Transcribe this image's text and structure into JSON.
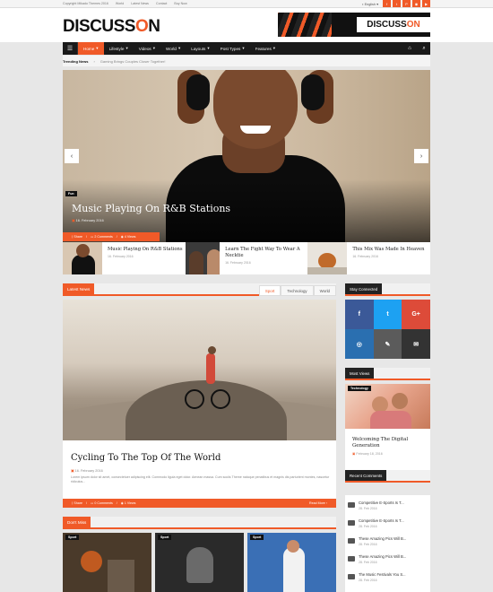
{
  "topbar": {
    "copyright": "Copyright Mikado Themes 2016",
    "links": [
      "World",
      "Latest News",
      "Contact",
      "Buy Now"
    ],
    "language": "English",
    "social": [
      "f",
      "t",
      "P",
      "◉",
      "▶"
    ]
  },
  "header": {
    "logo_main": "DISCUSS",
    "logo_accent": "O",
    "logo_end": "N",
    "banner_text_a": "DISCUSS",
    "banner_text_b": "ON"
  },
  "nav": {
    "items": [
      {
        "label": "Home",
        "active": true
      },
      {
        "label": "Lifestyle"
      },
      {
        "label": "Videos"
      },
      {
        "label": "World"
      },
      {
        "label": "Layouts"
      },
      {
        "label": "Post Types"
      },
      {
        "label": "Features"
      }
    ]
  },
  "trending": {
    "label": "Trending News",
    "text": "Gaming Brings Couples Closer Together!"
  },
  "hero": {
    "tag": "Fun",
    "title": "Music Playing On R&B Stations",
    "date": "16. February 2016",
    "share": "Share",
    "comments": "2 Comments",
    "views": "4 Views"
  },
  "thumbs": [
    {
      "title": "Music Playing On R&B Stations",
      "date": "16. February 2016"
    },
    {
      "title": "Learn The Fight Way To Wear A Necktie",
      "date": "16. February 2016"
    },
    {
      "title": "This Mix Was Made In Heaven",
      "date": "16. February 2016"
    }
  ],
  "latest": {
    "label": "Latest News",
    "tabs": [
      "Sport",
      "Technology",
      "World"
    ],
    "post_title": "Cycling To The Top Of The World",
    "post_date": "16. February 2016",
    "excerpt": "Lorem ipsum dolor sit amet, consectetuer adipiscing elit. Commodo ligula eget dolor. Aenean massa. Cum sociis Theme natoque penatibus et magnis dis parturient montes, nascetur ridiculus...",
    "share": "Share",
    "comments": "0 Comments",
    "views": "1 Views",
    "read_more": "Read More"
  },
  "dont_miss": {
    "label": "Don't Miss",
    "tags": [
      "Sport",
      "Sport",
      "Sport"
    ]
  },
  "sidebar": {
    "stay_connected": "Stay Connected",
    "social_tiles": [
      {
        "glyph": "f",
        "color": "#3b5998"
      },
      {
        "glyph": "t",
        "color": "#1da1f2"
      },
      {
        "glyph": "G+",
        "color": "#dd4b39"
      },
      {
        "glyph": "◎",
        "color": "#2a6fb0"
      },
      {
        "glyph": "✎",
        "color": "#5b5b5b"
      },
      {
        "glyph": "✉",
        "color": "#333333"
      }
    ],
    "most_views": "Most Views",
    "mv_tag": "Technology",
    "mv_title": "Welcoming The Digital Generation",
    "mv_date": "February 18, 2016",
    "recent_comments": "Recent Comments",
    "comments": [
      {
        "title": "Competitive E-Sports Is T...",
        "date": "28. Feb 2016"
      },
      {
        "title": "Competitive E-Sports Is T...",
        "date": "28. Feb 2016"
      },
      {
        "title": "These Amazing Pics Will B...",
        "date": "28. Feb 2016"
      },
      {
        "title": "These Amazing Pics Will B...",
        "date": "28. Feb 2016"
      },
      {
        "title": "The Music Festivals You S...",
        "date": "28. Feb 2016"
      }
    ]
  },
  "colors": {
    "accent": "#f05a28",
    "dark": "#1a1a1a"
  }
}
